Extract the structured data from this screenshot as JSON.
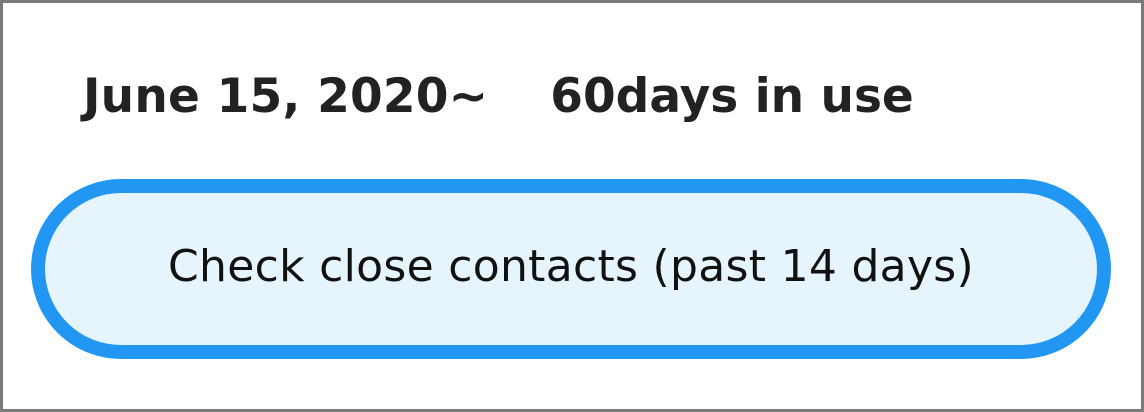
{
  "usage": {
    "start_date": "June 15, 2020~",
    "days_count": "60days",
    "days_suffix": " in use"
  },
  "actions": {
    "check_contacts_label": "Check close contacts (past 14 days)"
  },
  "colors": {
    "accent": "#2196f3",
    "button_fill": "#e6f4fd",
    "text": "#222222",
    "frame_border": "#7a7a7a"
  }
}
